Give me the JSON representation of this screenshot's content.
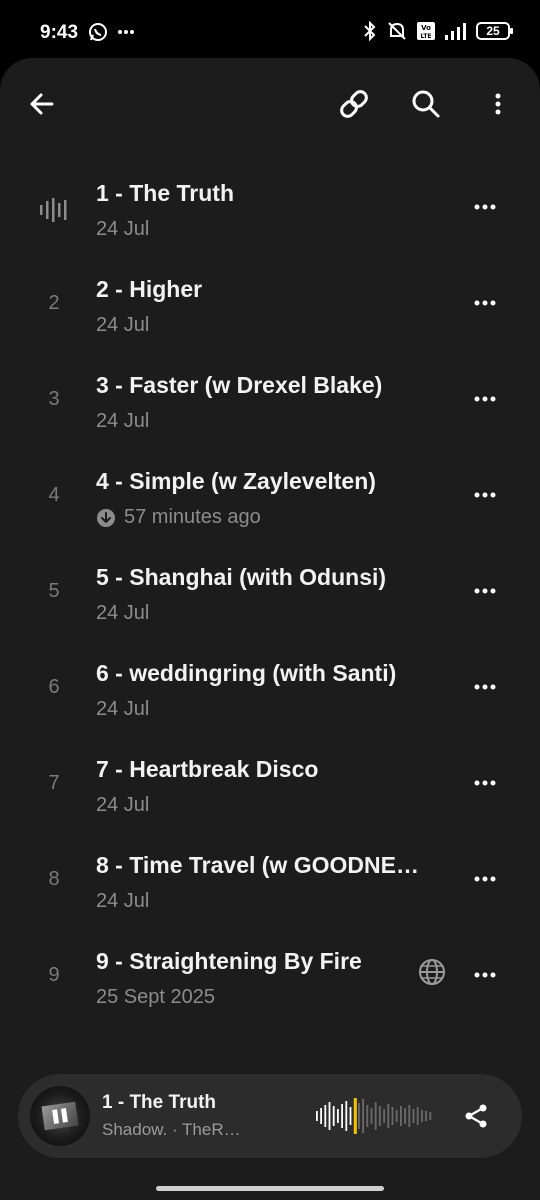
{
  "status_bar": {
    "time": "9:43",
    "battery": "25",
    "network": "LTE"
  },
  "toolbar": {
    "back_icon": "arrow-left-icon",
    "link_icon": "link-icon",
    "search_icon": "search-icon",
    "more_icon": "more-vertical-icon"
  },
  "tracks": [
    {
      "number": "1",
      "title": "1 - The Truth",
      "subtitle": "24 Jul",
      "playing": true
    },
    {
      "number": "2",
      "title": "2 - Higher",
      "subtitle": "24 Jul"
    },
    {
      "number": "3",
      "title": "3 - Faster (w Drexel Blake)",
      "subtitle": "24 Jul"
    },
    {
      "number": "4",
      "title": "4 - Simple (w Zaylevelten)",
      "subtitle": "57 minutes ago",
      "downloaded": true
    },
    {
      "number": "5",
      "title": "5 - Shanghai (with Odunsi)",
      "subtitle": "24 Jul"
    },
    {
      "number": "6",
      "title": "6 - weddingring (with Santi)",
      "subtitle": "24 Jul"
    },
    {
      "number": "7",
      "title": "7 - Heartbreak Disco",
      "subtitle": "24 Jul"
    },
    {
      "number": "8",
      "title": "8 - Time Travel (w GOODNE…",
      "subtitle": "24 Jul"
    },
    {
      "number": "9",
      "title": "9 - Straightening By Fire",
      "subtitle": "25 Sept 2025",
      "public": true
    }
  ],
  "now_playing": {
    "title": "1 - The Truth",
    "artist": "Shadow. · TheR…",
    "progress": 0.33,
    "accent_color": "#f5c400"
  },
  "colors": {
    "background": "#1c1c1c",
    "text_primary": "#f2f2f2",
    "text_secondary": "#8c8c8c"
  }
}
